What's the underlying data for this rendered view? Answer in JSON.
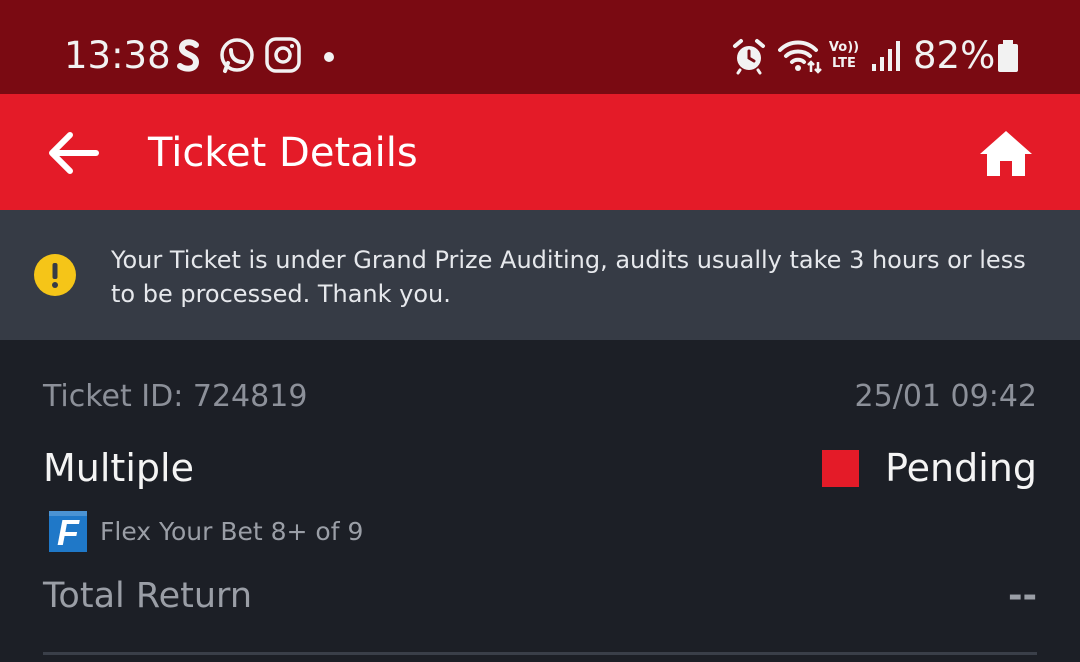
{
  "status_bar": {
    "time": "13:38",
    "battery": "82%",
    "icons": [
      "s-app-icon",
      "whatsapp-icon",
      "instagram-icon",
      "notification-dot-icon",
      "alarm-icon",
      "wifi-icon",
      "volte-icon",
      "signal-icon",
      "battery-icon"
    ],
    "volte_label_top": "Vo))",
    "volte_label_bottom": "LTE"
  },
  "app_bar": {
    "title": "Ticket Details",
    "back_icon": "arrow-left-icon",
    "home_icon": "home-icon"
  },
  "notice": {
    "icon": "warning-icon",
    "text": "Your Ticket is under Grand Prize Auditing, audits usually take 3 hours or less to be processed. Thank you."
  },
  "ticket": {
    "id_label": "Ticket ID: 724819",
    "datetime": "25/01 09:42",
    "bet_type": "Multiple",
    "status": "Pending",
    "flex_logo": "F",
    "flex_text": "Flex Your Bet 8+ of 9",
    "total_return_label": "Total Return",
    "total_return_value": "--"
  },
  "colors": {
    "status_bar": "#7a0a12",
    "app_bar": "#e41b28",
    "notice_bg": "#363b45",
    "content_bg": "#1c1f26",
    "warning_yellow": "#f5c518",
    "pending_red": "#e41b28",
    "flex_blue": "#1f78c8"
  }
}
